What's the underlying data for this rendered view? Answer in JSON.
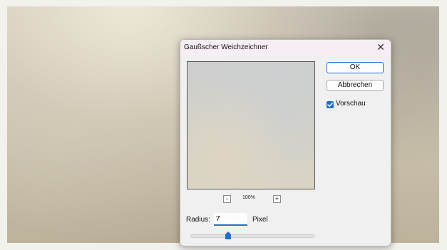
{
  "dialog": {
    "title": "Gaußscher Weichzeichner",
    "close_icon": "close-icon",
    "ok_label": "OK",
    "cancel_label": "Abbrechen",
    "preview_label": "Vorschau",
    "preview_checked": true,
    "zoom_out_label": "-",
    "zoom_in_label": "+",
    "zoom_level": "100%",
    "radius_label": "Radius:",
    "radius_value": "7",
    "radius_unit": "Pixel",
    "radius_slider_fraction": 0.31
  },
  "colors": {
    "accent": "#1f6ecb",
    "titlebar": "#f7eef5",
    "dialog_bg": "#f0f0f0"
  }
}
